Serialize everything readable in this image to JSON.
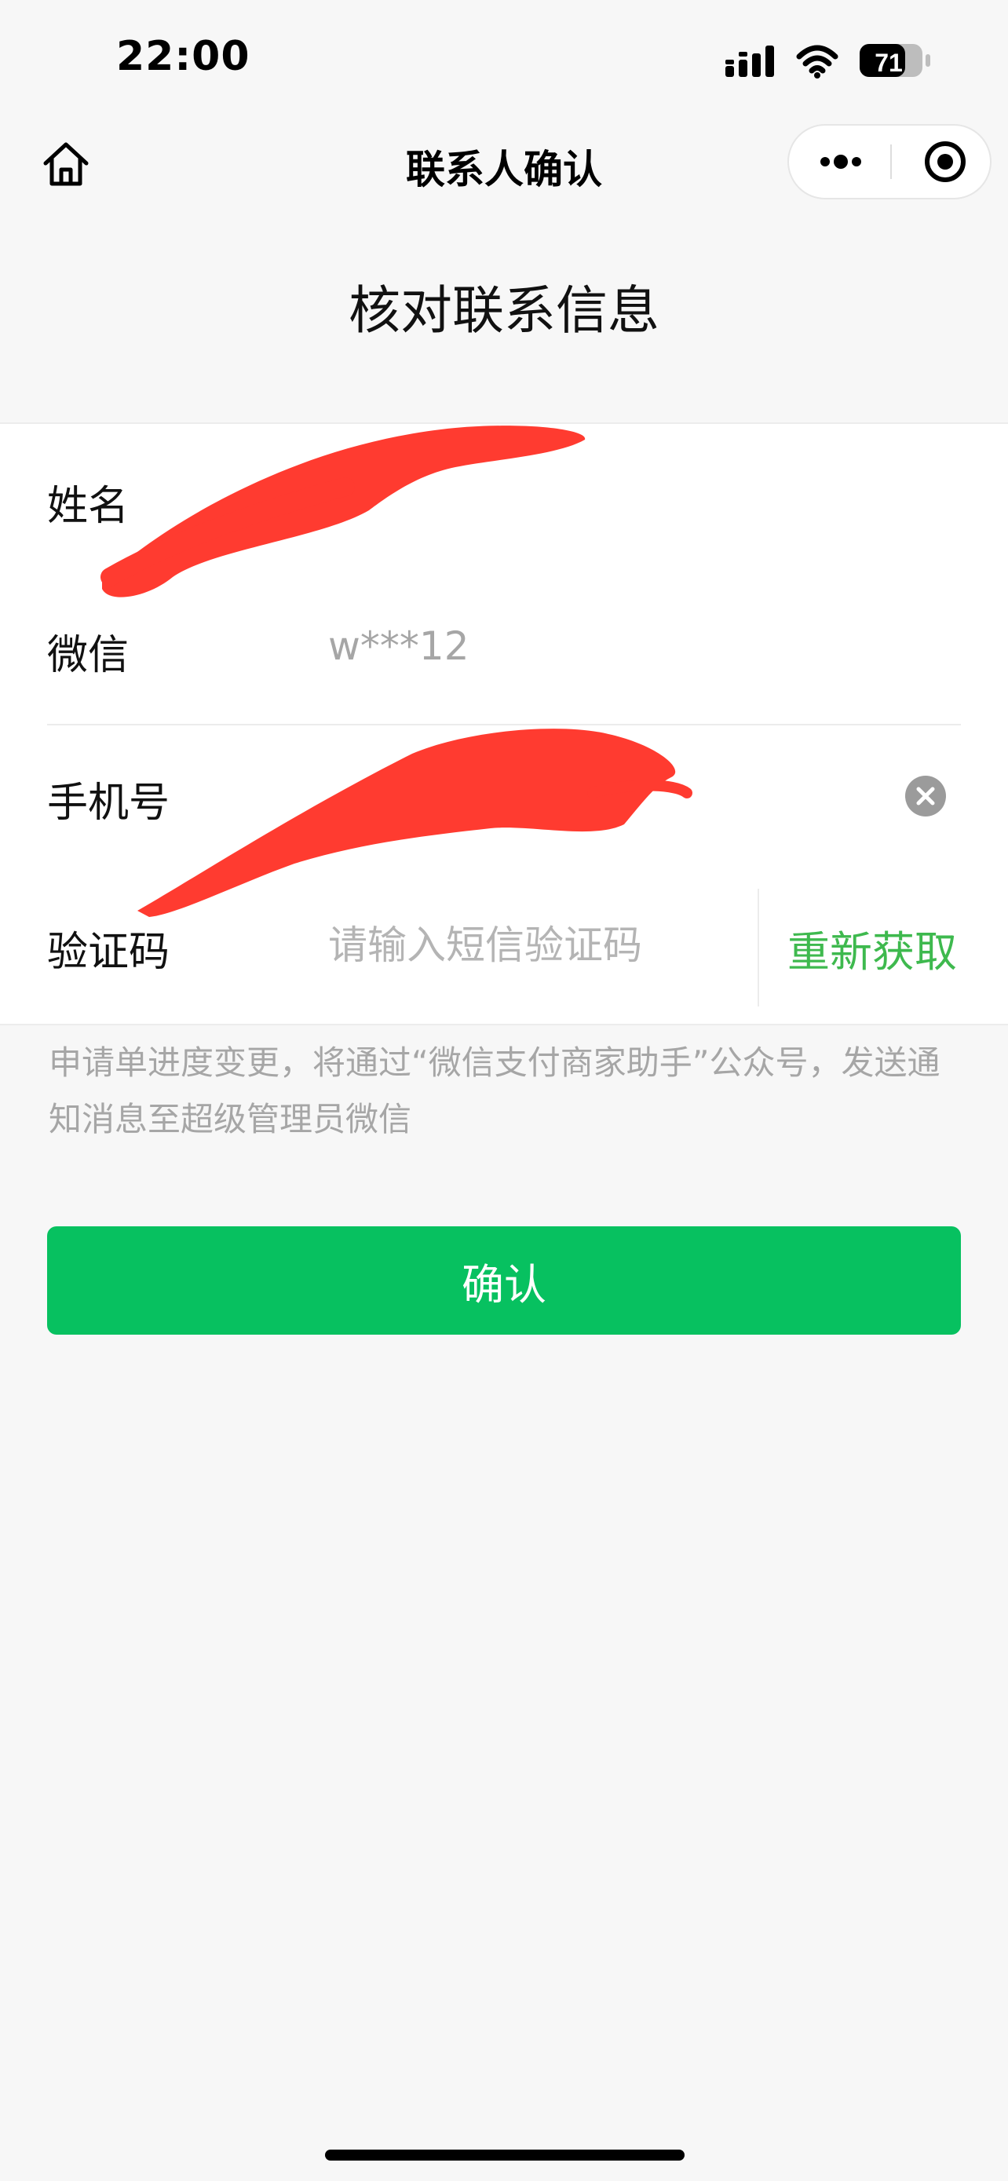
{
  "status_bar": {
    "time": "22:00",
    "battery": "71"
  },
  "nav": {
    "title": "联系人确认"
  },
  "heading": "核对联系信息",
  "form": {
    "name": {
      "label": "姓名",
      "value": ""
    },
    "wechat": {
      "label": "微信",
      "value": "w***12"
    },
    "phone": {
      "label": "手机号",
      "value": ""
    },
    "code": {
      "label": "验证码",
      "placeholder": "请输入短信验证码",
      "resend_label": "重新获取"
    }
  },
  "notice": "申请单进度变更，将通过“微信支付商家助手”公众号，发送通知消息至超级管理员微信",
  "confirm_label": "确认",
  "colors": {
    "accent_green": "#07c160",
    "link_green": "#3eb94e",
    "redaction_red": "#ff3b30"
  }
}
